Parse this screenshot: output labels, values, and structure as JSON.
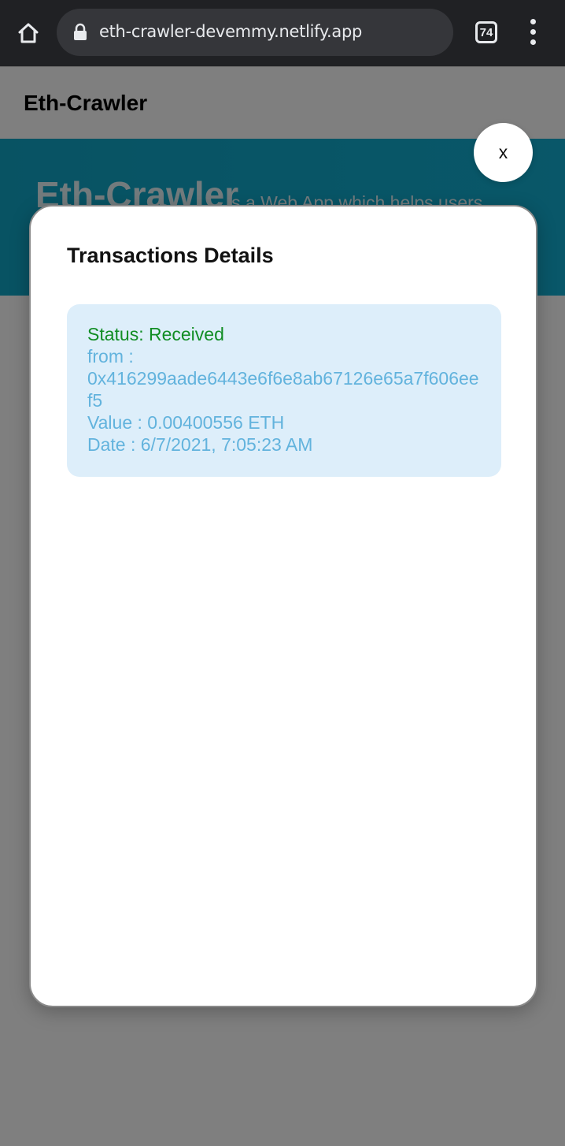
{
  "browser": {
    "url": "eth-crawler-devemmy.netlify.app",
    "tab_count": "74"
  },
  "site": {
    "title": "Eth-Crawler",
    "hero_title": "Eth-Crawler",
    "hero_subtitle": "is a Web App which helps users"
  },
  "modal": {
    "title": "Transactions Details",
    "close_label": "x",
    "transaction": {
      "status": "Status: Received",
      "from_label": "from :",
      "from_address": "0x416299aade6443e6f6e8ab67126e65a7f606eef5",
      "value": "Value : 0.00400556 ETH",
      "date": "Date : 6/7/2021, 7:05:23 AM"
    }
  },
  "colors": {
    "hero": "#12afd2",
    "status_received": "#118d24",
    "muted_text": "#62b3dd",
    "card_bg": "#ddeefa"
  },
  "icons": {
    "home": "home-icon",
    "lock": "lock-icon",
    "menu": "more-vert-icon"
  }
}
